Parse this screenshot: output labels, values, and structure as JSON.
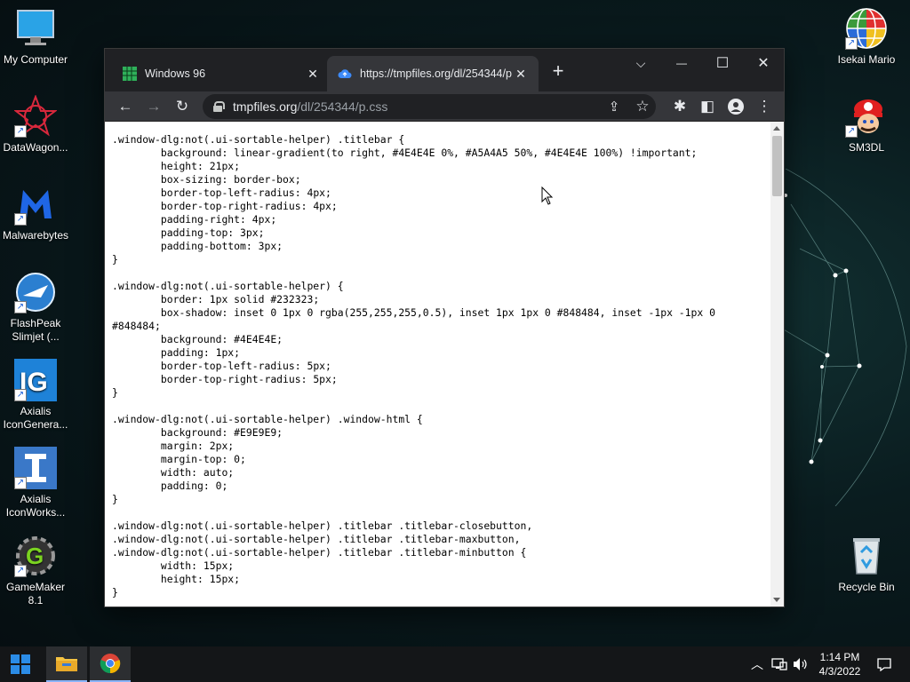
{
  "desktop": {
    "left_icons": [
      {
        "label": "My Computer",
        "icon": "computer-icon"
      },
      {
        "label": "DataWagon...",
        "icon": "datawagon-icon"
      },
      {
        "label": "Malwarebytes",
        "icon": "malwarebytes-icon"
      },
      {
        "label": "FlashPeak Slimjet (...",
        "icon": "slimjet-icon"
      },
      {
        "label": "Axialis IconGenera...",
        "icon": "axialis-icongenerator-icon"
      },
      {
        "label": "Axialis IconWorks...",
        "icon": "axialis-iconworkshop-icon"
      },
      {
        "label": "GameMaker 8.1",
        "icon": "gamemaker-icon"
      }
    ],
    "right_icons": [
      {
        "label": "Isekai Mario",
        "icon": "globe-icon"
      },
      {
        "label": "SM3DL",
        "icon": "mario-icon"
      },
      {
        "label": "Recycle Bin",
        "icon": "recycle-bin-icon"
      }
    ]
  },
  "browser": {
    "tabs": [
      {
        "title": "Windows 96",
        "icon": "windows96-favicon",
        "close": "✕"
      },
      {
        "title": "https://tmpfiles.org/dl/254344/p",
        "icon": "cloud-favicon",
        "close": "✕"
      }
    ],
    "new_tab": "+",
    "window_controls": {
      "dropdown": "⌵",
      "minimize": "—",
      "maximize": "☐",
      "close": "✕"
    },
    "toolbar": {
      "back": "←",
      "forward": "→",
      "reload": "↻",
      "share": "⇪",
      "star": "☆",
      "extensions": "✱",
      "sidepanel": "◧",
      "menu": "⋮"
    },
    "address": {
      "domain": "tmpfiles.org",
      "path": "/dl/254344/p.css"
    },
    "content": ".window-dlg:not(.ui-sortable-helper) .titlebar {\n        background: linear-gradient(to right, #4E4E4E 0%, #A5A4A5 50%, #4E4E4E 100%) !important;\n        height: 21px;\n        box-sizing: border-box;\n        border-top-left-radius: 4px;\n        border-top-right-radius: 4px;\n        padding-right: 4px;\n        padding-top: 3px;\n        padding-bottom: 3px;\n}\n\n.window-dlg:not(.ui-sortable-helper) {\n        border: 1px solid #232323;\n        box-shadow: inset 0 1px 0 rgba(255,255,255,0.5), inset 1px 1px 0 #848484, inset -1px -1px 0\n#848484;\n        background: #4E4E4E;\n        padding: 1px;\n        border-top-left-radius: 5px;\n        border-top-right-radius: 5px;\n}\n\n.window-dlg:not(.ui-sortable-helper) .window-html {\n        background: #E9E9E9;\n        margin: 2px;\n        margin-top: 0;\n        width: auto;\n        padding: 0;\n}\n\n.window-dlg:not(.ui-sortable-helper) .titlebar .titlebar-closebutton,\n.window-dlg:not(.ui-sortable-helper) .titlebar .titlebar-maxbutton,\n.window-dlg:not(.ui-sortable-helper) .titlebar .titlebar-minbutton {\n        width: 15px;\n        height: 15px;\n}"
  },
  "taskbar": {
    "start_icon": "windows-start-icon",
    "pinned": [
      {
        "name": "File Explorer",
        "icon": "folder-icon"
      },
      {
        "name": "Google Chrome",
        "icon": "chrome-icon"
      }
    ],
    "tray": {
      "chevron": "︿",
      "network": "network-icon",
      "volume": "volume-icon",
      "notifications": "notification-icon"
    },
    "clock": {
      "time": "1:14 PM",
      "date": "4/3/2022"
    }
  },
  "colors": {
    "tabbar": "#202124",
    "toolbar": "#35363a",
    "accent": "#8ab4f8"
  }
}
